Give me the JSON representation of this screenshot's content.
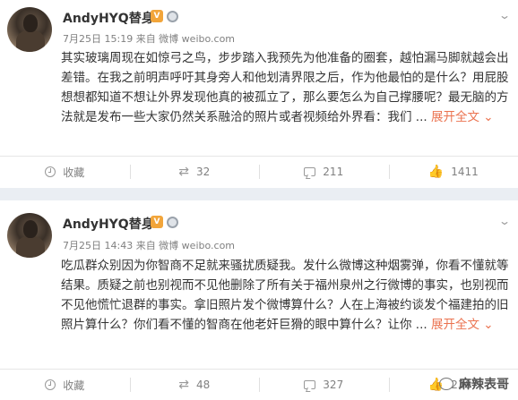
{
  "posts": [
    {
      "username": "AndyHYQ替身",
      "vip_badge": "V",
      "meta": "7月25日 15:19 来自 微博 weibo.com",
      "content": "其实玻璃周现在如惊弓之鸟，步步踏入我预先为他准备的圈套，越怕漏马脚就越会出差错。在我之前明声呼吁其身旁人和他划清界限之后，作为他最怕的是什么？用屁股想想都知道不想让外界发现他真的被孤立了，那么要怎么为自己撑腰呢？最无脑的方法就是发布一些大家仍然关系融洽的照片或者视频给外界看：我们",
      "ellipsis": " ...",
      "expand_label": "展开全文",
      "expand_arrow": "⌄",
      "actions": {
        "favorite": "收藏",
        "repost": "32",
        "comment": "211",
        "like": "1411"
      }
    },
    {
      "username": "AndyHYQ替身",
      "vip_badge": "V",
      "meta": "7月25日 14:43 来自 微博 weibo.com",
      "content": "吃瓜群众别因为你智商不足就来骚扰质疑我。发什么微博这种烟雾弹，你看不懂就等结果。质疑之前也别视而不见他删除了所有关于福州泉州之行微博的事实，也别视而不见他慌忙退群的事实。拿旧照片发个微博算什么？人在上海被约谈发个福建拍的旧照片算什么？你们看不懂的智商在他老奸巨猾的眼中算什么？让你",
      "ellipsis": " ...",
      "expand_label": "展开全文",
      "expand_arrow": "⌄",
      "actions": {
        "favorite": "收藏",
        "repost": "48",
        "comment": "327",
        "like": "2307"
      }
    }
  ],
  "watermark": "麻辣表哥",
  "icons": {
    "menu": "chevron-down-icon",
    "favorite": "star-icon",
    "repost": "repost-icon",
    "comment": "comment-icon",
    "like": "thumbs-up-icon",
    "vip": "vip-badge-icon",
    "medal": "medal-icon"
  },
  "colors": {
    "expand": "#eb7350",
    "separator": "#eaeef3",
    "meta": "#808080"
  }
}
